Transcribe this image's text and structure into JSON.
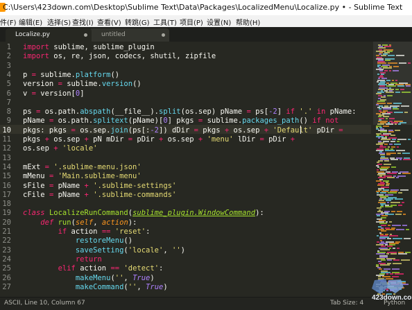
{
  "window": {
    "title": "C:\\Users\\423down.com\\Desktop\\Sublime Text\\Data\\Packages\\LocalizedMenu\\Localize.py • - Sublime Text"
  },
  "menu": {
    "items": [
      "件(F)",
      "编辑(E)",
      "选择(S)",
      "查找(I)",
      "查看(V)",
      "转跳(G)",
      "工具(T)",
      "项目(P)",
      "设置(N)",
      "帮助(H)"
    ]
  },
  "tabs": [
    {
      "label": "Localize.py",
      "active": true
    },
    {
      "label": "untitled",
      "active": false
    }
  ],
  "editor": {
    "current_line": 10,
    "theme_colors": {
      "background": "#272822",
      "text": "#f8f8f2",
      "keyword": "#f92672",
      "string": "#e6db74",
      "function": "#66d9ef",
      "class_name": "#a6e22e",
      "number": "#ae81ff",
      "param": "#fd971f"
    },
    "lines": [
      {
        "n": "1",
        "parts": [
          {
            "t": "import",
            "c": "k"
          },
          {
            "t": " sublime, sublime_plugin"
          }
        ]
      },
      {
        "n": "2",
        "parts": [
          {
            "t": "import",
            "c": "k"
          },
          {
            "t": " os, re, json, codecs, shutil, zipfile"
          }
        ]
      },
      {
        "n": "3",
        "parts": []
      },
      {
        "n": "4",
        "parts": [
          {
            "t": "p "
          },
          {
            "t": "=",
            "c": "k"
          },
          {
            "t": " sublime."
          },
          {
            "t": "platform",
            "c": "f"
          },
          {
            "t": "()"
          }
        ]
      },
      {
        "n": "5",
        "parts": [
          {
            "t": "version "
          },
          {
            "t": "=",
            "c": "k"
          },
          {
            "t": " sublime."
          },
          {
            "t": "version",
            "c": "f"
          },
          {
            "t": "()"
          }
        ]
      },
      {
        "n": "6",
        "parts": [
          {
            "t": "v "
          },
          {
            "t": "=",
            "c": "k"
          },
          {
            "t": " version["
          },
          {
            "t": "0",
            "c": "n"
          },
          {
            "t": "]"
          }
        ]
      },
      {
        "n": "7",
        "parts": []
      },
      {
        "n": "8",
        "parts": [
          {
            "t": "ps "
          },
          {
            "t": "=",
            "c": "k"
          },
          {
            "t": " os.path."
          },
          {
            "t": "abspath",
            "c": "f"
          },
          {
            "t": "(__file__)."
          },
          {
            "t": "split",
            "c": "f"
          },
          {
            "t": "(os.sep) pName "
          },
          {
            "t": "=",
            "c": "k"
          },
          {
            "t": " ps["
          },
          {
            "t": "-2",
            "c": "n"
          },
          {
            "t": "] "
          },
          {
            "t": "if",
            "c": "k"
          },
          {
            "t": " "
          },
          {
            "t": "'.'",
            "c": "s"
          },
          {
            "t": " "
          },
          {
            "t": "in",
            "c": "k"
          },
          {
            "t": " pName:"
          }
        ]
      },
      {
        "n": "9",
        "parts": [
          {
            "t": "pName "
          },
          {
            "t": "=",
            "c": "k"
          },
          {
            "t": " os.path."
          },
          {
            "t": "splitext",
            "c": "f"
          },
          {
            "t": "(pName)["
          },
          {
            "t": "0",
            "c": "n"
          },
          {
            "t": "] pkgs "
          },
          {
            "t": "=",
            "c": "k"
          },
          {
            "t": " sublime."
          },
          {
            "t": "packages_path",
            "c": "f"
          },
          {
            "t": "() "
          },
          {
            "t": "if",
            "c": "k"
          },
          {
            "t": " "
          },
          {
            "t": "not",
            "c": "k"
          }
        ]
      },
      {
        "n": "10",
        "parts": [
          {
            "t": "pkgs: pkgs "
          },
          {
            "t": "=",
            "c": "k"
          },
          {
            "t": " os.sep."
          },
          {
            "t": "join",
            "c": "f"
          },
          {
            "t": "(ps[:"
          },
          {
            "t": "-2",
            "c": "n"
          },
          {
            "t": "]) dDir "
          },
          {
            "t": "=",
            "c": "k"
          },
          {
            "t": " pkgs "
          },
          {
            "t": "+",
            "c": "k"
          },
          {
            "t": " os.sep "
          },
          {
            "t": "+",
            "c": "k"
          },
          {
            "t": " "
          },
          {
            "t": "'Default'",
            "c": "s"
          },
          {
            "t": " pDir "
          },
          {
            "t": "=",
            "c": "k"
          }
        ]
      },
      {
        "n": "11",
        "parts": [
          {
            "t": "pkgs "
          },
          {
            "t": "+",
            "c": "k"
          },
          {
            "t": " os.sep "
          },
          {
            "t": "+",
            "c": "k"
          },
          {
            "t": " pN mDir "
          },
          {
            "t": "=",
            "c": "k"
          },
          {
            "t": " pDir "
          },
          {
            "t": "+",
            "c": "k"
          },
          {
            "t": " os.sep "
          },
          {
            "t": "+",
            "c": "k"
          },
          {
            "t": " "
          },
          {
            "t": "'menu'",
            "c": "s"
          },
          {
            "t": " lDir "
          },
          {
            "t": "=",
            "c": "k"
          },
          {
            "t": " pDir "
          },
          {
            "t": "+",
            "c": "k"
          }
        ]
      },
      {
        "n": "12",
        "parts": [
          {
            "t": "os.sep "
          },
          {
            "t": "+",
            "c": "k"
          },
          {
            "t": " "
          },
          {
            "t": "'locale'",
            "c": "s"
          }
        ]
      },
      {
        "n": "13",
        "parts": []
      },
      {
        "n": "14",
        "parts": [
          {
            "t": "mExt "
          },
          {
            "t": "=",
            "c": "k"
          },
          {
            "t": " "
          },
          {
            "t": "'.sublime-menu.json'",
            "c": "s"
          }
        ]
      },
      {
        "n": "15",
        "parts": [
          {
            "t": "mMenu "
          },
          {
            "t": "=",
            "c": "k"
          },
          {
            "t": " "
          },
          {
            "t": "'Main.sublime-menu'",
            "c": "s"
          }
        ]
      },
      {
        "n": "16",
        "parts": [
          {
            "t": "sFile "
          },
          {
            "t": "=",
            "c": "k"
          },
          {
            "t": " pName "
          },
          {
            "t": "+",
            "c": "k"
          },
          {
            "t": " "
          },
          {
            "t": "'.sublime-settings'",
            "c": "s"
          }
        ]
      },
      {
        "n": "17",
        "parts": [
          {
            "t": "cFile "
          },
          {
            "t": "=",
            "c": "k"
          },
          {
            "t": " pName "
          },
          {
            "t": "+",
            "c": "k"
          },
          {
            "t": " "
          },
          {
            "t": "'.sublime-commands'",
            "c": "s"
          }
        ]
      },
      {
        "n": "18",
        "parts": []
      },
      {
        "n": "19",
        "parts": [
          {
            "t": "class",
            "c": "ki"
          },
          {
            "t": " "
          },
          {
            "t": "LocalizeRunCommand",
            "c": "cn"
          },
          {
            "t": "("
          },
          {
            "t": "sublime_plugin.WindowCommand",
            "c": "ci"
          },
          {
            "t": "):"
          }
        ]
      },
      {
        "n": "20",
        "parts": [
          {
            "t": "    "
          },
          {
            "t": "def",
            "c": "ki"
          },
          {
            "t": " "
          },
          {
            "t": "run",
            "c": "cn"
          },
          {
            "t": "("
          },
          {
            "t": "self",
            "c": "pi"
          },
          {
            "t": ", "
          },
          {
            "t": "action",
            "c": "pi"
          },
          {
            "t": "):"
          }
        ]
      },
      {
        "n": "21",
        "parts": [
          {
            "t": "        "
          },
          {
            "t": "if",
            "c": "k"
          },
          {
            "t": " action "
          },
          {
            "t": "==",
            "c": "k"
          },
          {
            "t": " "
          },
          {
            "t": "'reset'",
            "c": "s"
          },
          {
            "t": ":"
          }
        ]
      },
      {
        "n": "22",
        "parts": [
          {
            "t": "            "
          },
          {
            "t": "restoreMenu",
            "c": "f"
          },
          {
            "t": "()"
          }
        ]
      },
      {
        "n": "23",
        "parts": [
          {
            "t": "            "
          },
          {
            "t": "saveSetting",
            "c": "f"
          },
          {
            "t": "("
          },
          {
            "t": "'locale'",
            "c": "s"
          },
          {
            "t": ", "
          },
          {
            "t": "''",
            "c": "s"
          },
          {
            "t": ")"
          }
        ]
      },
      {
        "n": "24",
        "parts": [
          {
            "t": "            "
          },
          {
            "t": "return",
            "c": "k"
          }
        ]
      },
      {
        "n": "25",
        "parts": [
          {
            "t": "        "
          },
          {
            "t": "elif",
            "c": "k"
          },
          {
            "t": " action "
          },
          {
            "t": "==",
            "c": "k"
          },
          {
            "t": " "
          },
          {
            "t": "'detect'",
            "c": "s"
          },
          {
            "t": ":"
          }
        ]
      },
      {
        "n": "26",
        "parts": [
          {
            "t": "            "
          },
          {
            "t": "makeMenu",
            "c": "f"
          },
          {
            "t": "("
          },
          {
            "t": "''",
            "c": "s"
          },
          {
            "t": ", "
          },
          {
            "t": "True",
            "c": "ni"
          },
          {
            "t": ")"
          }
        ]
      },
      {
        "n": "27",
        "parts": [
          {
            "t": "            "
          },
          {
            "t": "makeCommand",
            "c": "f"
          },
          {
            "t": "("
          },
          {
            "t": "''",
            "c": "s"
          },
          {
            "t": ", "
          },
          {
            "t": "True",
            "c": "ni"
          },
          {
            "t": ")"
          }
        ]
      }
    ]
  },
  "status": {
    "left": "ASCII, Line 10, Column 67",
    "tab_size": "Tab Size: 4",
    "syntax": "Python"
  },
  "watermark": {
    "text": "423down.com"
  }
}
